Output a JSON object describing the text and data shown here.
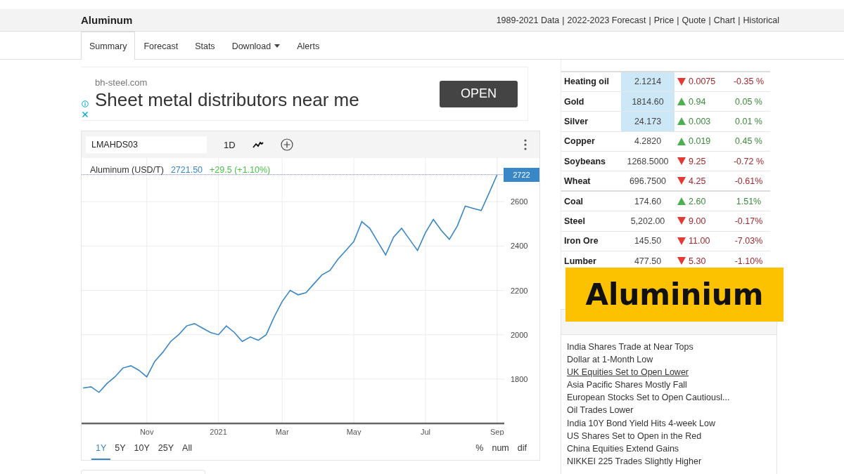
{
  "header": {
    "title": "Aluminum",
    "separator": "|",
    "links": [
      "1989-2021 Data",
      "2022-2023 Forecast",
      "Price",
      "Quote",
      "Chart",
      "Historical"
    ]
  },
  "tabs": [
    {
      "label": "Summary",
      "selected": true,
      "has_menu": false
    },
    {
      "label": "Forecast",
      "selected": false,
      "has_menu": false
    },
    {
      "label": "Stats",
      "selected": false,
      "has_menu": false
    },
    {
      "label": "Download",
      "selected": false,
      "has_menu": true
    },
    {
      "label": "Alerts",
      "selected": false,
      "has_menu": false
    }
  ],
  "ad": {
    "domain": "bh-steel.com",
    "headline": "Sheet metal distributors near me",
    "button": "OPEN"
  },
  "chart_panel": {
    "symbol": "LMAHDS03",
    "interval": "1D",
    "legend": {
      "name": "Aluminum (USD/T)",
      "price": "2721.50",
      "change": "+29.5 (+1.10%)"
    },
    "chart_data": {
      "type": "line",
      "categories": [
        null,
        null,
        null,
        null,
        null,
        null,
        null,
        null,
        "Nov",
        null,
        null,
        null,
        null,
        null,
        null,
        null,
        null,
        "2021",
        null,
        null,
        null,
        null,
        null,
        null,
        null,
        "Mar",
        null,
        null,
        null,
        null,
        null,
        null,
        null,
        null,
        "May",
        null,
        null,
        null,
        null,
        null,
        null,
        null,
        null,
        "Jul",
        null,
        null,
        null,
        null,
        null,
        null,
        null,
        null,
        "Sep"
      ],
      "series": [
        {
          "color": "#3a87c8",
          "values": [
            1760,
            1765,
            1740,
            1780,
            1810,
            1850,
            1860,
            1840,
            1810,
            1880,
            1920,
            1970,
            2000,
            2040,
            2050,
            2030,
            2010,
            2000,
            2040,
            2010,
            1970,
            1990,
            1975,
            2000,
            2080,
            2150,
            2200,
            2180,
            2190,
            2230,
            2270,
            2290,
            2340,
            2380,
            2420,
            2510,
            2480,
            2420,
            2360,
            2440,
            2480,
            2430,
            2380,
            2460,
            2520,
            2470,
            2430,
            2490,
            2580,
            2570,
            2560,
            2640,
            2722
          ]
        }
      ],
      "ylim": [
        1600,
        2797
      ],
      "yticks": [
        1800,
        2000,
        2200,
        2400,
        2600
      ],
      "grid": true,
      "ref_lines": [
        {
          "axis": "y",
          "value": 2722,
          "label": "2722",
          "color": "#7b7be0"
        }
      ]
    },
    "ranges": [
      {
        "label": "1Y",
        "selected": true
      },
      {
        "label": "5Y",
        "selected": false
      },
      {
        "label": "10Y",
        "selected": false
      },
      {
        "label": "25Y",
        "selected": false
      },
      {
        "label": "All",
        "selected": false
      }
    ],
    "display_modes": [
      "%",
      "num",
      "dif"
    ]
  },
  "commodities": [
    {
      "name": "Heating oil",
      "price": "2.1214",
      "change": "0.0075",
      "percent": "-0.35 %",
      "kind": "down",
      "highlighted": true
    },
    {
      "name": "Gold",
      "price": "1814.60",
      "change": "0.94",
      "percent": "0.05 %",
      "kind": "up",
      "highlighted": true
    },
    {
      "name": "Silver",
      "price": "24.173",
      "change": "0.003",
      "percent": "0.01 %",
      "kind": "up",
      "highlighted": true
    },
    {
      "name": "Copper",
      "price": "4.2820",
      "change": "0.019",
      "percent": "0.45 %",
      "kind": "up",
      "highlighted": false
    },
    {
      "name": "Soybeans",
      "price": "1268.5000",
      "change": "9.25",
      "percent": "-0.72 %",
      "kind": "down",
      "highlighted": false
    },
    {
      "name": "Wheat",
      "price": "696.7500",
      "change": "4.25",
      "percent": "-0.61%",
      "kind": "down",
      "highlighted": false
    },
    {
      "name": "Coal",
      "price": "174.60",
      "change": "2.60",
      "percent": "1.51%",
      "kind": "up",
      "highlighted": false
    },
    {
      "name": "Steel",
      "price": "5,202.00",
      "change": "9.00",
      "percent": "-0.17%",
      "kind": "down",
      "highlighted": false
    },
    {
      "name": "Iron Ore",
      "price": "145.50",
      "change": "11.00",
      "percent": "-7.03%",
      "kind": "down",
      "highlighted": false
    },
    {
      "name": "Lumber",
      "price": "477.50",
      "change": "5.30",
      "percent": "-1.10%",
      "kind": "down",
      "highlighted": false
    }
  ],
  "news": {
    "items": [
      {
        "title": "India Shares Trade at Near Tops",
        "hovered": false
      },
      {
        "title": "Dollar at 1-Month Low",
        "hovered": false
      },
      {
        "title": "UK Equities Set to Open Lower",
        "hovered": true
      },
      {
        "title": "Asia Pacific Shares Mostly Fall",
        "hovered": false
      },
      {
        "title": "European Stocks Set to Open Cautiousl...",
        "hovered": false
      },
      {
        "title": "Oil Trades Lower",
        "hovered": false
      },
      {
        "title": "India 10Y Bond Yield Hits 4-week Low",
        "hovered": false
      },
      {
        "title": "US Shares Set to Open in the Red",
        "hovered": false
      },
      {
        "title": "China Equities Extend Gains",
        "hovered": false
      },
      {
        "title": "NIKKEI 225 Trades Slightly Higher",
        "hovered": false
      }
    ]
  },
  "banner": {
    "text": "Aluminium"
  }
}
